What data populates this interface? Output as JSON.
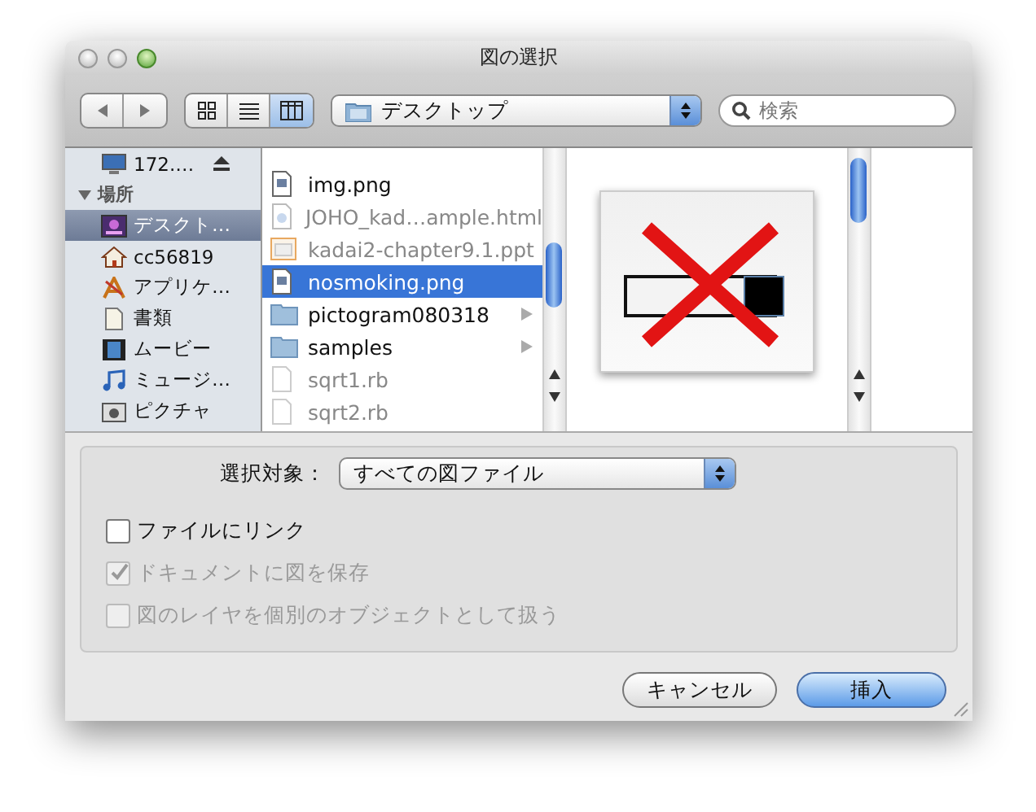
{
  "window": {
    "title": "図の選択"
  },
  "toolbar": {
    "views": [
      {
        "kind": "icons",
        "selected": false
      },
      {
        "kind": "list",
        "selected": false
      },
      {
        "kind": "columns",
        "selected": true
      }
    ],
    "location": "デスクトップ",
    "search": {
      "placeholder": "検索"
    }
  },
  "sidebar": {
    "items": [
      {
        "label": "172.…",
        "kind": "network",
        "selected": false
      }
    ],
    "sections": [
      {
        "title": "場所",
        "expanded": true,
        "items": [
          {
            "label": "デスクト…",
            "kind": "desktop",
            "selected": true
          },
          {
            "label": "cc56819",
            "kind": "home",
            "selected": false
          },
          {
            "label": "アプリケ…",
            "kind": "apps",
            "selected": false
          },
          {
            "label": "書類",
            "kind": "docs",
            "selected": false
          },
          {
            "label": "ムービー",
            "kind": "movies",
            "selected": false
          },
          {
            "label": "ミュージ…",
            "kind": "music",
            "selected": false
          },
          {
            "label": "ピクチャ",
            "kind": "pictures",
            "selected": false
          }
        ]
      }
    ]
  },
  "files": [
    {
      "name": "img.png",
      "kind": "image",
      "selected": false,
      "disabled": false
    },
    {
      "name": "JOHO_kad…ample.html",
      "kind": "html",
      "selected": false,
      "disabled": true
    },
    {
      "name": "kadai2-chapter9.1.ppt",
      "kind": "ppt",
      "selected": false,
      "disabled": true
    },
    {
      "name": "nosmoking.png",
      "kind": "image",
      "selected": true,
      "disabled": false
    },
    {
      "name": "pictogram080318",
      "kind": "folder",
      "selected": false,
      "disabled": false
    },
    {
      "name": "samples",
      "kind": "folder",
      "selected": false,
      "disabled": false
    },
    {
      "name": "sqrt1.rb",
      "kind": "rb",
      "selected": false,
      "disabled": true
    },
    {
      "name": "sqrt2.rb",
      "kind": "rb",
      "selected": false,
      "disabled": true
    }
  ],
  "options": {
    "filter_label": "選択対象：",
    "filter_value": "すべての図ファイル",
    "checkboxes": [
      {
        "label": "ファイルにリンク",
        "checked": false,
        "disabled": false
      },
      {
        "label": "ドキュメントに図を保存",
        "checked": true,
        "disabled": true
      },
      {
        "label": "図のレイヤを個別のオブジェクトとして扱う",
        "checked": false,
        "disabled": true
      }
    ]
  },
  "buttons": [
    {
      "label": "キャンセル",
      "default": false
    },
    {
      "label": "挿入",
      "default": true
    }
  ]
}
